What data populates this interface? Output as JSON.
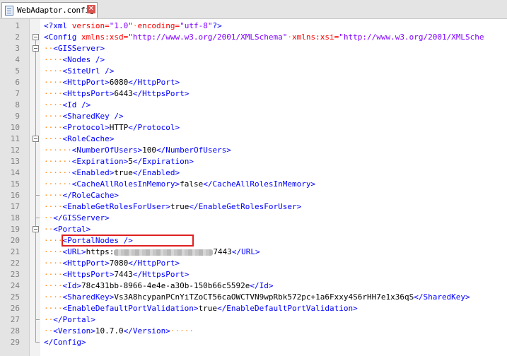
{
  "tab": {
    "label": "WebAdaptor.config",
    "close_icon": "close-icon",
    "close_glyph": "✕"
  },
  "lines": [
    {
      "num": "1",
      "fold": "none",
      "segs": [
        [
          "t",
          "<?xml "
        ],
        [
          "a",
          "version="
        ],
        [
          "v",
          "\"1.0\""
        ],
        [
          "ws",
          "·"
        ],
        [
          "a",
          "encoding="
        ],
        [
          "v",
          "\"utf-8\""
        ],
        [
          "t",
          "?>"
        ]
      ]
    },
    {
      "num": "2",
      "fold": "box",
      "segs": [
        [
          "t",
          "<Config "
        ],
        [
          "a",
          "xmlns:xsd="
        ],
        [
          "v",
          "\"http://www.w3.org/2001/XMLSchema\""
        ],
        [
          "ws",
          "·"
        ],
        [
          "a",
          "xmlns:xsi="
        ],
        [
          "v",
          "\"http://www.w3.org/2001/XMLSche"
        ]
      ]
    },
    {
      "num": "3",
      "fold": "box",
      "segs": [
        [
          "ws",
          "··"
        ],
        [
          "t",
          "<GISServer>"
        ]
      ]
    },
    {
      "num": "4",
      "fold": "line",
      "segs": [
        [
          "ws",
          "····"
        ],
        [
          "t",
          "<Nodes />"
        ]
      ]
    },
    {
      "num": "5",
      "fold": "line",
      "segs": [
        [
          "ws",
          "····"
        ],
        [
          "t",
          "<SiteUrl />"
        ]
      ]
    },
    {
      "num": "6",
      "fold": "line",
      "segs": [
        [
          "ws",
          "····"
        ],
        [
          "t",
          "<HttpPort>"
        ],
        [
          "txt",
          "6080"
        ],
        [
          "t",
          "</HttpPort>"
        ]
      ]
    },
    {
      "num": "7",
      "fold": "line",
      "segs": [
        [
          "ws",
          "····"
        ],
        [
          "t",
          "<HttpsPort>"
        ],
        [
          "txt",
          "6443"
        ],
        [
          "t",
          "</HttpsPort>"
        ]
      ]
    },
    {
      "num": "8",
      "fold": "line",
      "segs": [
        [
          "ws",
          "····"
        ],
        [
          "t",
          "<Id />"
        ]
      ]
    },
    {
      "num": "9",
      "fold": "line",
      "segs": [
        [
          "ws",
          "····"
        ],
        [
          "t",
          "<SharedKey />"
        ]
      ]
    },
    {
      "num": "10",
      "fold": "line",
      "segs": [
        [
          "ws",
          "····"
        ],
        [
          "t",
          "<Protocol>"
        ],
        [
          "txt",
          "HTTP"
        ],
        [
          "t",
          "</Protocol>"
        ]
      ]
    },
    {
      "num": "11",
      "fold": "box",
      "segs": [
        [
          "ws",
          "····"
        ],
        [
          "t",
          "<RoleCache>"
        ]
      ]
    },
    {
      "num": "12",
      "fold": "line",
      "segs": [
        [
          "ws",
          "······"
        ],
        [
          "t",
          "<NumberOfUsers>"
        ],
        [
          "txt",
          "100"
        ],
        [
          "t",
          "</NumberOfUsers>"
        ]
      ]
    },
    {
      "num": "13",
      "fold": "line",
      "segs": [
        [
          "ws",
          "······"
        ],
        [
          "t",
          "<Expiration>"
        ],
        [
          "txt",
          "5"
        ],
        [
          "t",
          "</Expiration>"
        ]
      ]
    },
    {
      "num": "14",
      "fold": "line",
      "segs": [
        [
          "ws",
          "······"
        ],
        [
          "t",
          "<Enabled>"
        ],
        [
          "txt",
          "true"
        ],
        [
          "t",
          "</Enabled>"
        ]
      ]
    },
    {
      "num": "15",
      "fold": "line",
      "segs": [
        [
          "ws",
          "······"
        ],
        [
          "t",
          "<CacheAllRolesInMemory>"
        ],
        [
          "txt",
          "false"
        ],
        [
          "t",
          "</CacheAllRolesInMemory>"
        ]
      ]
    },
    {
      "num": "16",
      "fold": "end",
      "segs": [
        [
          "ws",
          "····"
        ],
        [
          "t",
          "</RoleCache>"
        ]
      ]
    },
    {
      "num": "17",
      "fold": "line",
      "segs": [
        [
          "ws",
          "····"
        ],
        [
          "t",
          "<EnableGetRolesForUser>"
        ],
        [
          "txt",
          "true"
        ],
        [
          "t",
          "</EnableGetRolesForUser>"
        ]
      ]
    },
    {
      "num": "18",
      "fold": "end",
      "segs": [
        [
          "ws",
          "··"
        ],
        [
          "t",
          "</GISServer>"
        ]
      ]
    },
    {
      "num": "19",
      "fold": "box",
      "segs": [
        [
          "ws",
          "··"
        ],
        [
          "t",
          "<Portal>"
        ]
      ]
    },
    {
      "num": "20",
      "fold": "line",
      "segs": [
        [
          "ws",
          "····"
        ],
        [
          "t",
          "<PortalNodes />"
        ]
      ]
    },
    {
      "num": "21",
      "fold": "line",
      "segs": [
        [
          "ws",
          "····"
        ],
        [
          "t",
          "<URL>"
        ],
        [
          "txt",
          "https:"
        ],
        [
          "blur",
          ""
        ],
        [
          "txt",
          "7443"
        ],
        [
          "t",
          "</URL>"
        ]
      ]
    },
    {
      "num": "22",
      "fold": "line",
      "segs": [
        [
          "ws",
          "····"
        ],
        [
          "t",
          "<HttpPort>"
        ],
        [
          "txt",
          "7080"
        ],
        [
          "t",
          "</HttpPort>"
        ]
      ]
    },
    {
      "num": "23",
      "fold": "line",
      "segs": [
        [
          "ws",
          "····"
        ],
        [
          "t",
          "<HttpsPort>"
        ],
        [
          "txt",
          "7443"
        ],
        [
          "t",
          "</HttpsPort>"
        ]
      ]
    },
    {
      "num": "24",
      "fold": "line",
      "segs": [
        [
          "ws",
          "····"
        ],
        [
          "t",
          "<Id>"
        ],
        [
          "txt",
          "78c431bb-8966-4e4e-a30b-150b66c5592e"
        ],
        [
          "t",
          "</Id>"
        ]
      ]
    },
    {
      "num": "25",
      "fold": "line",
      "segs": [
        [
          "ws",
          "····"
        ],
        [
          "t",
          "<SharedKey>"
        ],
        [
          "txt",
          "Vs3A8hcypanPCnYiTZoCT56caOWCTVN9wpRbk572pc+1a6Fxxy4S6rHH7e1x36qS"
        ],
        [
          "t",
          "</SharedKey>"
        ]
      ]
    },
    {
      "num": "26",
      "fold": "line",
      "segs": [
        [
          "ws",
          "····"
        ],
        [
          "t",
          "<EnableDefaultPortValidation>"
        ],
        [
          "txt",
          "true"
        ],
        [
          "t",
          "</EnableDefaultPortValidation>"
        ]
      ]
    },
    {
      "num": "27",
      "fold": "end",
      "segs": [
        [
          "ws",
          "··"
        ],
        [
          "t",
          "</Portal>"
        ]
      ]
    },
    {
      "num": "28",
      "fold": "line",
      "segs": [
        [
          "ws",
          "··"
        ],
        [
          "t",
          "<Version>"
        ],
        [
          "txt",
          "10.7.0"
        ],
        [
          "t",
          "</Version>"
        ],
        [
          "ws",
          "·····"
        ]
      ]
    },
    {
      "num": "29",
      "fold": "end",
      "segs": [
        [
          "t",
          "</Config>"
        ]
      ]
    }
  ],
  "highlight": {
    "line": "20",
    "color": "#e02020"
  },
  "colors": {
    "tag": "#0000ff",
    "attr": "#ff0000",
    "value": "#8000ff",
    "whitespace": "#ff8c1a",
    "text": "#000000"
  }
}
